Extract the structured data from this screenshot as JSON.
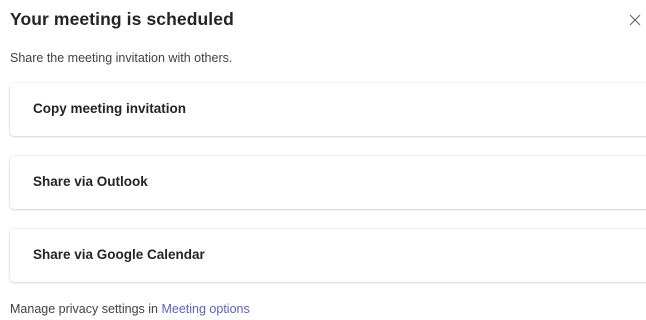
{
  "dialog": {
    "title": "Your meeting is scheduled",
    "subtitle": "Share the meeting invitation with others.",
    "close_icon": "close-icon"
  },
  "options": [
    {
      "label": "Copy meeting invitation"
    },
    {
      "label": "Share via Outlook"
    },
    {
      "label": "Share via Google Calendar"
    }
  ],
  "footer": {
    "text": "Manage privacy settings in ",
    "link_label": "Meeting options",
    "link_color": "#5b5fc7"
  }
}
